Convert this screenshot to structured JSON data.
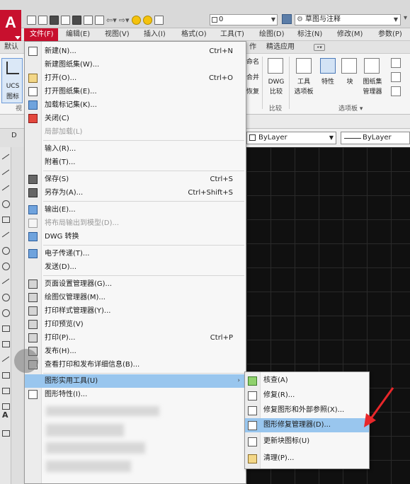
{
  "titlebar": {
    "layer_value": "0",
    "workspace": "草图与注释"
  },
  "menubar": {
    "items": [
      "文件(F)",
      "编辑(E)",
      "视图(V)",
      "插入(I)",
      "格式(O)",
      "工具(T)",
      "绘图(D)",
      "标注(N)",
      "修改(M)",
      "参数(P)"
    ]
  },
  "ribbon": {
    "tabs": [
      "默认",
      "作",
      "精选应用"
    ],
    "ucs_label_1": "UCS",
    "ucs_label_2": "图标",
    "left_cut_label": "视",
    "side_labels": [
      "命名",
      "合并",
      "恢复"
    ],
    "dwg_label_1": "DWG",
    "dwg_label_2": "比较",
    "compare_group": "比较",
    "tool_palette_1": "工具",
    "tool_palette_2": "选项板",
    "properties": "特性",
    "block": "块",
    "sheetset_1": "图纸集",
    "sheetset_2": "管理器",
    "palette_group": "选项板 ▾"
  },
  "propbar": {
    "tab_label": "D",
    "color": "ByLayer",
    "linetype": "ByLayer"
  },
  "file_menu": {
    "items": [
      {
        "label": "新建(N)...",
        "shortcut": "Ctrl+N",
        "icon": "new-icon"
      },
      {
        "label": "新建图纸集(W)...",
        "shortcut": "",
        "icon": ""
      },
      {
        "label": "打开(O)...",
        "shortcut": "Ctrl+O",
        "icon": "open-icon"
      },
      {
        "label": "打开图纸集(E)...",
        "shortcut": "",
        "icon": "open-sheetset-icon"
      },
      {
        "label": "加载标记集(K)...",
        "shortcut": "",
        "icon": "markup-icon"
      },
      {
        "label": "关闭(C)",
        "shortcut": "",
        "icon": "close-icon"
      },
      {
        "label": "局部加载(L)",
        "shortcut": "",
        "icon": "",
        "disabled": true
      },
      {
        "label": "输入(R)...",
        "shortcut": "",
        "icon": ""
      },
      {
        "label": "附着(T)...",
        "shortcut": "",
        "icon": ""
      },
      {
        "label": "保存(S)",
        "shortcut": "Ctrl+S",
        "icon": "save-icon"
      },
      {
        "label": "另存为(A)...",
        "shortcut": "Ctrl+Shift+S",
        "icon": "save-as-icon"
      },
      {
        "label": "输出(E)...",
        "shortcut": "",
        "icon": "export-icon"
      },
      {
        "label": "将布局输出到模型(D)...",
        "shortcut": "",
        "icon": "",
        "disabled": true
      },
      {
        "label": "DWG 转换",
        "shortcut": "",
        "icon": "dwg-convert-icon"
      },
      {
        "label": "电子传递(T)...",
        "shortcut": "",
        "icon": "etransmit-icon"
      },
      {
        "label": "发送(D)...",
        "shortcut": "",
        "icon": ""
      },
      {
        "label": "页面设置管理器(G)...",
        "shortcut": "",
        "icon": "page-setup-icon"
      },
      {
        "label": "绘图仪管理器(M)...",
        "shortcut": "",
        "icon": "plotter-icon"
      },
      {
        "label": "打印样式管理器(Y)...",
        "shortcut": "",
        "icon": "plot-style-icon"
      },
      {
        "label": "打印预览(V)",
        "shortcut": "",
        "icon": "preview-icon"
      },
      {
        "label": "打印(P)...",
        "shortcut": "Ctrl+P",
        "icon": "print-icon"
      },
      {
        "label": "发布(H)...",
        "shortcut": "",
        "icon": "publish-icon"
      },
      {
        "label": "查看打印和发布详细信息(B)...",
        "shortcut": "",
        "icon": "plot-details-icon"
      },
      {
        "label": "图形实用工具(U)",
        "shortcut": "",
        "icon": "",
        "submenu": true
      },
      {
        "label": "图形特性(I)...",
        "shortcut": "",
        "icon": "drawing-props-icon"
      }
    ]
  },
  "utilities_submenu": {
    "items": [
      {
        "label": "核查(A)",
        "icon": "audit-icon"
      },
      {
        "label": "修复(R)...",
        "icon": "recover-icon"
      },
      {
        "label": "修复图形和外部参照(X)...",
        "icon": "recover-xref-icon"
      },
      {
        "label": "图形修复管理器(D)...",
        "icon": "recovery-manager-icon",
        "highlighted": true
      },
      {
        "label": "更新块图标(U)",
        "icon": "update-block-icon"
      },
      {
        "label": "清理(P)...",
        "icon": "purge-icon"
      }
    ]
  },
  "colors": {
    "accent_red": "#c8102e",
    "highlight": "#99c6ee",
    "canvas": "#101010"
  }
}
